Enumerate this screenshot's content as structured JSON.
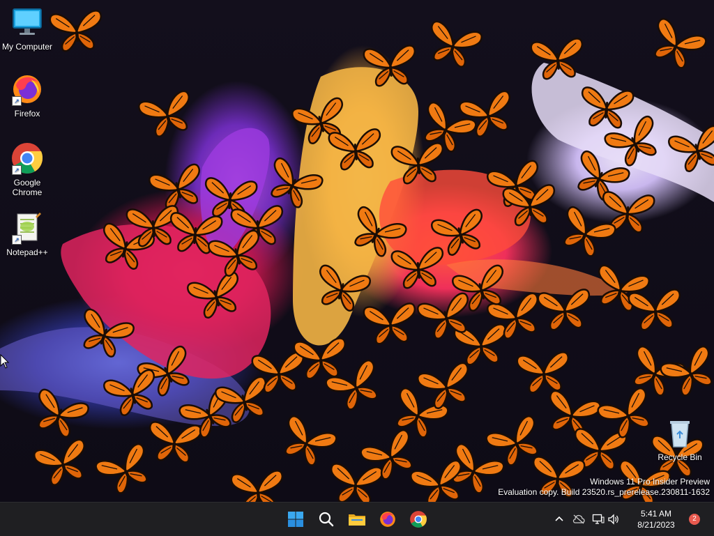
{
  "desktop": {
    "icons": [
      {
        "label": "My Computer",
        "icon": "monitor-icon"
      },
      {
        "label": "Firefox",
        "icon": "firefox-icon"
      },
      {
        "label": "Google Chrome",
        "icon": "chrome-icon"
      },
      {
        "label": "Notepad++",
        "icon": "notepad-plus-plus-icon"
      }
    ],
    "recycle_bin": {
      "label": "Recycle Bin",
      "icon": "recycle-bin-icon"
    },
    "watermark": {
      "line1": "Windows 11 Pro Insider Preview",
      "line2": "Evaluation copy. Build 23520.rs_prerelease.230811-1632"
    },
    "wallpaper": {
      "description_colors": [
        "#e8245a",
        "#f6d067",
        "#ff5a3b",
        "#c9b7ee"
      ],
      "butterfly_color": "#f07a12"
    }
  },
  "taskbar": {
    "buttons": [
      {
        "name": "start",
        "icon": "windows-start-icon"
      },
      {
        "name": "search",
        "icon": "search-icon"
      },
      {
        "name": "file-explorer",
        "icon": "folder-icon"
      },
      {
        "name": "firefox",
        "icon": "firefox-icon"
      },
      {
        "name": "chrome",
        "icon": "chrome-icon"
      }
    ],
    "tray": {
      "icons": [
        "chevron-up-icon",
        "cloud-offline-icon",
        "network-icon",
        "speaker-icon"
      ],
      "time": "5:41 AM",
      "date": "8/21/2023",
      "notification_count": "2"
    }
  }
}
